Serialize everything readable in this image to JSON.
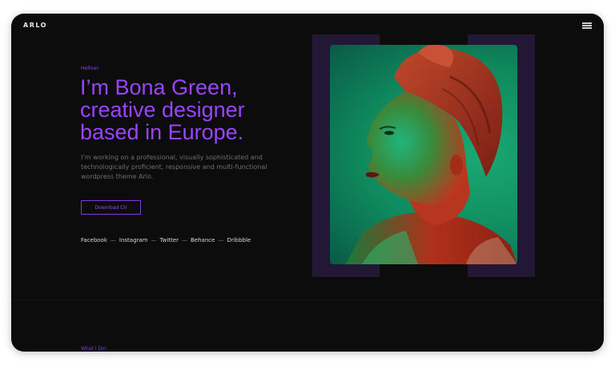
{
  "header": {
    "logo": "ARLO",
    "menu_icon": "hamburger-menu-icon"
  },
  "hero": {
    "greeting": "Hellow!",
    "headline": [
      "I’m Bona Green,",
      "creative designer",
      "based in Europe."
    ],
    "intro": "I’m working on a professional, visually sophisticated and technologically proficient, responsive and multi-functional wordpress theme Arlo.",
    "cv_button": "Download CV",
    "social": [
      "Facebook",
      "Instagram",
      "Twitter",
      "Behance",
      "Dribbble"
    ],
    "separator": "—"
  },
  "next_section": {
    "label": "What I Do!"
  },
  "colors": {
    "background": "#0c0c0d",
    "accent": "#9a44ff",
    "text_muted": "#6f6f73",
    "photo_frame": "#221835"
  }
}
